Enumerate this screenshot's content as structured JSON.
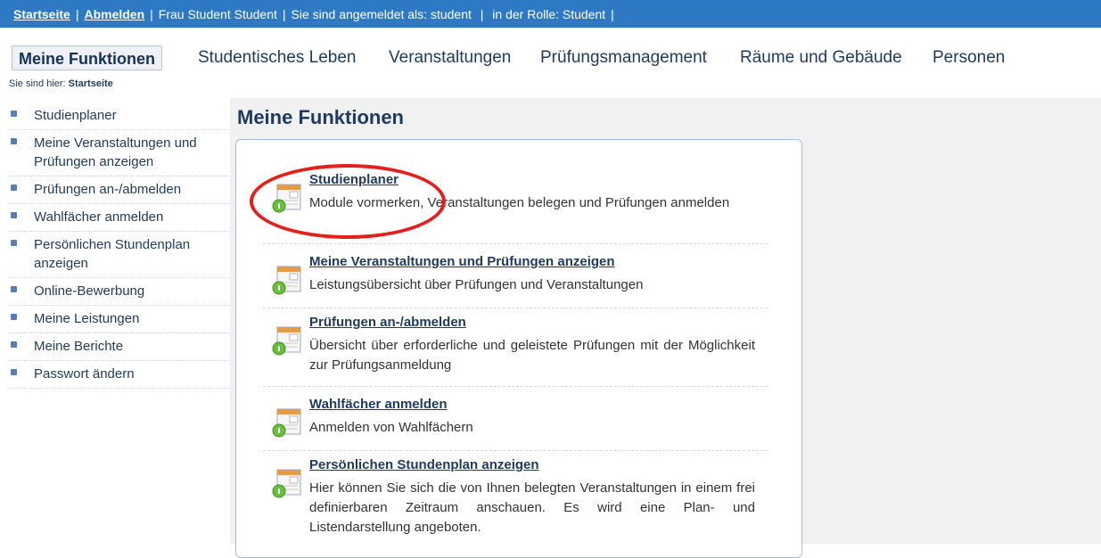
{
  "topbar": {
    "home": "Startseite",
    "logout": "Abmelden",
    "user": "Frau Student Student",
    "logged_in_as": "Sie sind angemeldet als: student",
    "role": "in der Rolle: Student"
  },
  "nav": {
    "items": [
      "Meine Funktionen",
      "Studentisches Leben",
      "Veranstaltungen",
      "Prüfungsmanagement",
      "Räume und Gebäude",
      "Personen"
    ]
  },
  "breadcrumb": {
    "prefix": "Sie sind hier:",
    "current": "Startseite"
  },
  "sidebar": {
    "items": [
      "Studienplaner",
      "Meine Veranstaltungen und Prüfungen anzeigen",
      "Prüfungen an-/abmelden",
      "Wahlfächer anmelden",
      "Persönlichen Stundenplan anzeigen",
      "Online-Bewerbung",
      "Meine Leistungen",
      "Meine Berichte",
      "Passwort ändern"
    ]
  },
  "main": {
    "title": "Meine Funktionen",
    "entries": [
      {
        "title": "Studienplaner",
        "desc": "Module vormerken, Veranstaltungen belegen und Prüfungen anmelden"
      },
      {
        "title": "Meine Veranstaltungen und Prüfungen anzeigen",
        "desc": "Leistungsübersicht über Prüfungen und Veranstaltungen"
      },
      {
        "title": "Prüfungen an-/abmelden",
        "desc": "Übersicht über erforderliche und geleistete Prüfungen mit der Möglichkeit zur Prüfungsanmeldung"
      },
      {
        "title": "Wahlfächer anmelden",
        "desc": "Anmelden von Wahlfächern"
      },
      {
        "title": "Persönlichen Stundenplan anzeigen",
        "desc": "Hier können Sie sich die von Ihnen belegten Veranstaltungen in einem frei definierbaren Zeitraum anschauen. Es wird eine Plan- und Listendarstellung angeboten."
      }
    ]
  },
  "colors": {
    "topbar": "#2d79c4",
    "text": "#1e3a5c",
    "highlight": "#e2211c"
  },
  "icons": {
    "entry": "calendar-info-icon",
    "sidebar_bullet": "square-bullet-icon"
  }
}
